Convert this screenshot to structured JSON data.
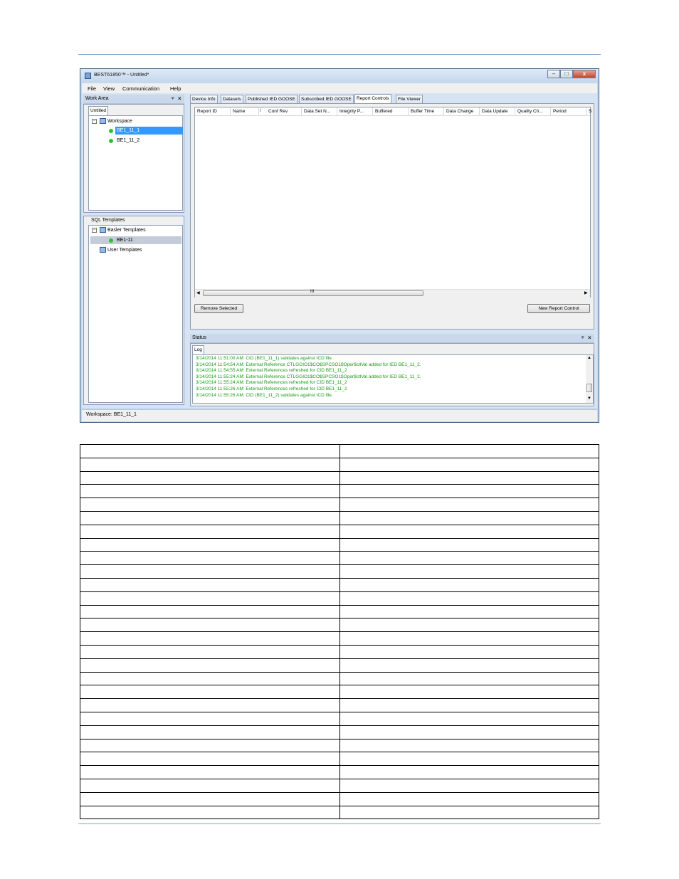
{
  "window": {
    "title": "BEST61850™ - Untitled*",
    "controls": {
      "minimize": "–",
      "maximize": "□",
      "close": "x"
    }
  },
  "menu": [
    "File",
    "View",
    "Communication",
    "Help"
  ],
  "work_area": {
    "title": "Work Area",
    "tab": "Untitled",
    "tree": {
      "root": "Workspace",
      "items": [
        "BE1_11_1",
        "BE1_11_2"
      ]
    }
  },
  "sql_templates": {
    "title": "SQL Templates",
    "basler": "Basler Templates",
    "basler_item": "BE1-11",
    "user": "User Templates"
  },
  "main_tabs": [
    "Device Info",
    "Datasets",
    "Published IED GOOSE",
    "Subscribed IED GOOSE",
    "Report Controls",
    "File Viewer"
  ],
  "active_tab": "Report Controls",
  "columns": [
    "Report ID",
    "Name",
    "Conf Rev",
    "Data Set N...",
    "Integrity P...",
    "Buffered",
    "Buffer Time",
    "Data Change",
    "Data Update",
    "Quality Ch...",
    "Period",
    "S"
  ],
  "sort_indicator": "/",
  "scroll_grip": "III",
  "buttons": {
    "remove": "Remove Selected",
    "new": "New Report Control"
  },
  "status": {
    "title": "Status",
    "tab": "Log",
    "lines": [
      "3/14/2014 11:51:00 AM: CID (BE1_11_1) validates against ICD file.",
      "3/14/2014 11:54:54 AM: External Reference CTLGGIO1$CO$SPCSO1$Oper$ctlVal added for IED BE1_11_2.",
      "3/14/2014 11:54:55 AM: External References refreshed for CID BE1_11_2",
      "3/14/2014 11:55:24 AM: External Reference CTLGGIO1$CO$SPCSO1$Oper$ctlVal added for IED BE1_11_2.",
      "3/14/2014 11:55:24 AM: External References refreshed for CID BE1_11_2",
      "3/14/2014 11:55:26 AM: External References refreshed for CID BE1_11_2",
      "3/14/2014 11:55:26 AM: CID (BE1_11_2) validates against ICD file."
    ]
  },
  "statusbar": "Workspace: BE1_11_1",
  "table": {
    "rows": 28,
    "cols": 2
  }
}
